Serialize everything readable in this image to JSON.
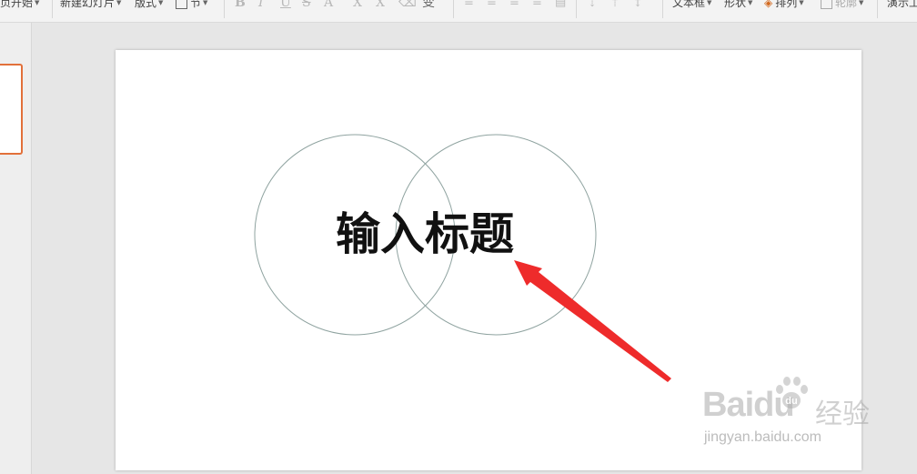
{
  "toolbar": {
    "page_start": "页开始",
    "new_slide": "新建幻灯片",
    "layout": "版式",
    "section": "节",
    "text_box": "文本框",
    "shape": "形状",
    "arrange": "排列",
    "outline": "轮廓",
    "presentation": "演示工"
  },
  "slide": {
    "title": "输入标题"
  },
  "watermark": {
    "logo": "Baidu",
    "suffix": "经验",
    "url": "jingyan.baidu.com"
  },
  "colors": {
    "thumb_border": "#e2703a",
    "circle_stroke": "#8fa3a0",
    "arrow": "#ee2b2b"
  }
}
